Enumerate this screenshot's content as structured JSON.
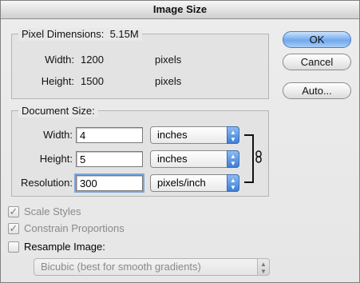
{
  "window": {
    "title": "Image Size"
  },
  "pixel_dimensions": {
    "title": "Pixel Dimensions:",
    "size": "5.15M",
    "width": {
      "label": "Width:",
      "value": "1200",
      "unit": "pixels"
    },
    "height": {
      "label": "Height:",
      "value": "1500",
      "unit": "pixels"
    }
  },
  "document_size": {
    "title": "Document Size:",
    "width": {
      "label": "Width:",
      "value": "4",
      "unit": "inches"
    },
    "height": {
      "label": "Height:",
      "value": "5",
      "unit": "inches"
    },
    "resolution": {
      "label": "Resolution:",
      "value": "300",
      "unit": "pixels/inch"
    }
  },
  "buttons": {
    "ok": "OK",
    "cancel": "Cancel",
    "auto": "Auto..."
  },
  "options": {
    "scale_styles": "Scale Styles",
    "constrain_proportions": "Constrain Proportions",
    "resample_image": "Resample Image:",
    "resample_method": "Bicubic (best for smooth gradients)"
  },
  "icons": {
    "link": "chain-link-icon",
    "checkmark": "✓",
    "arrows": "▲▼"
  }
}
